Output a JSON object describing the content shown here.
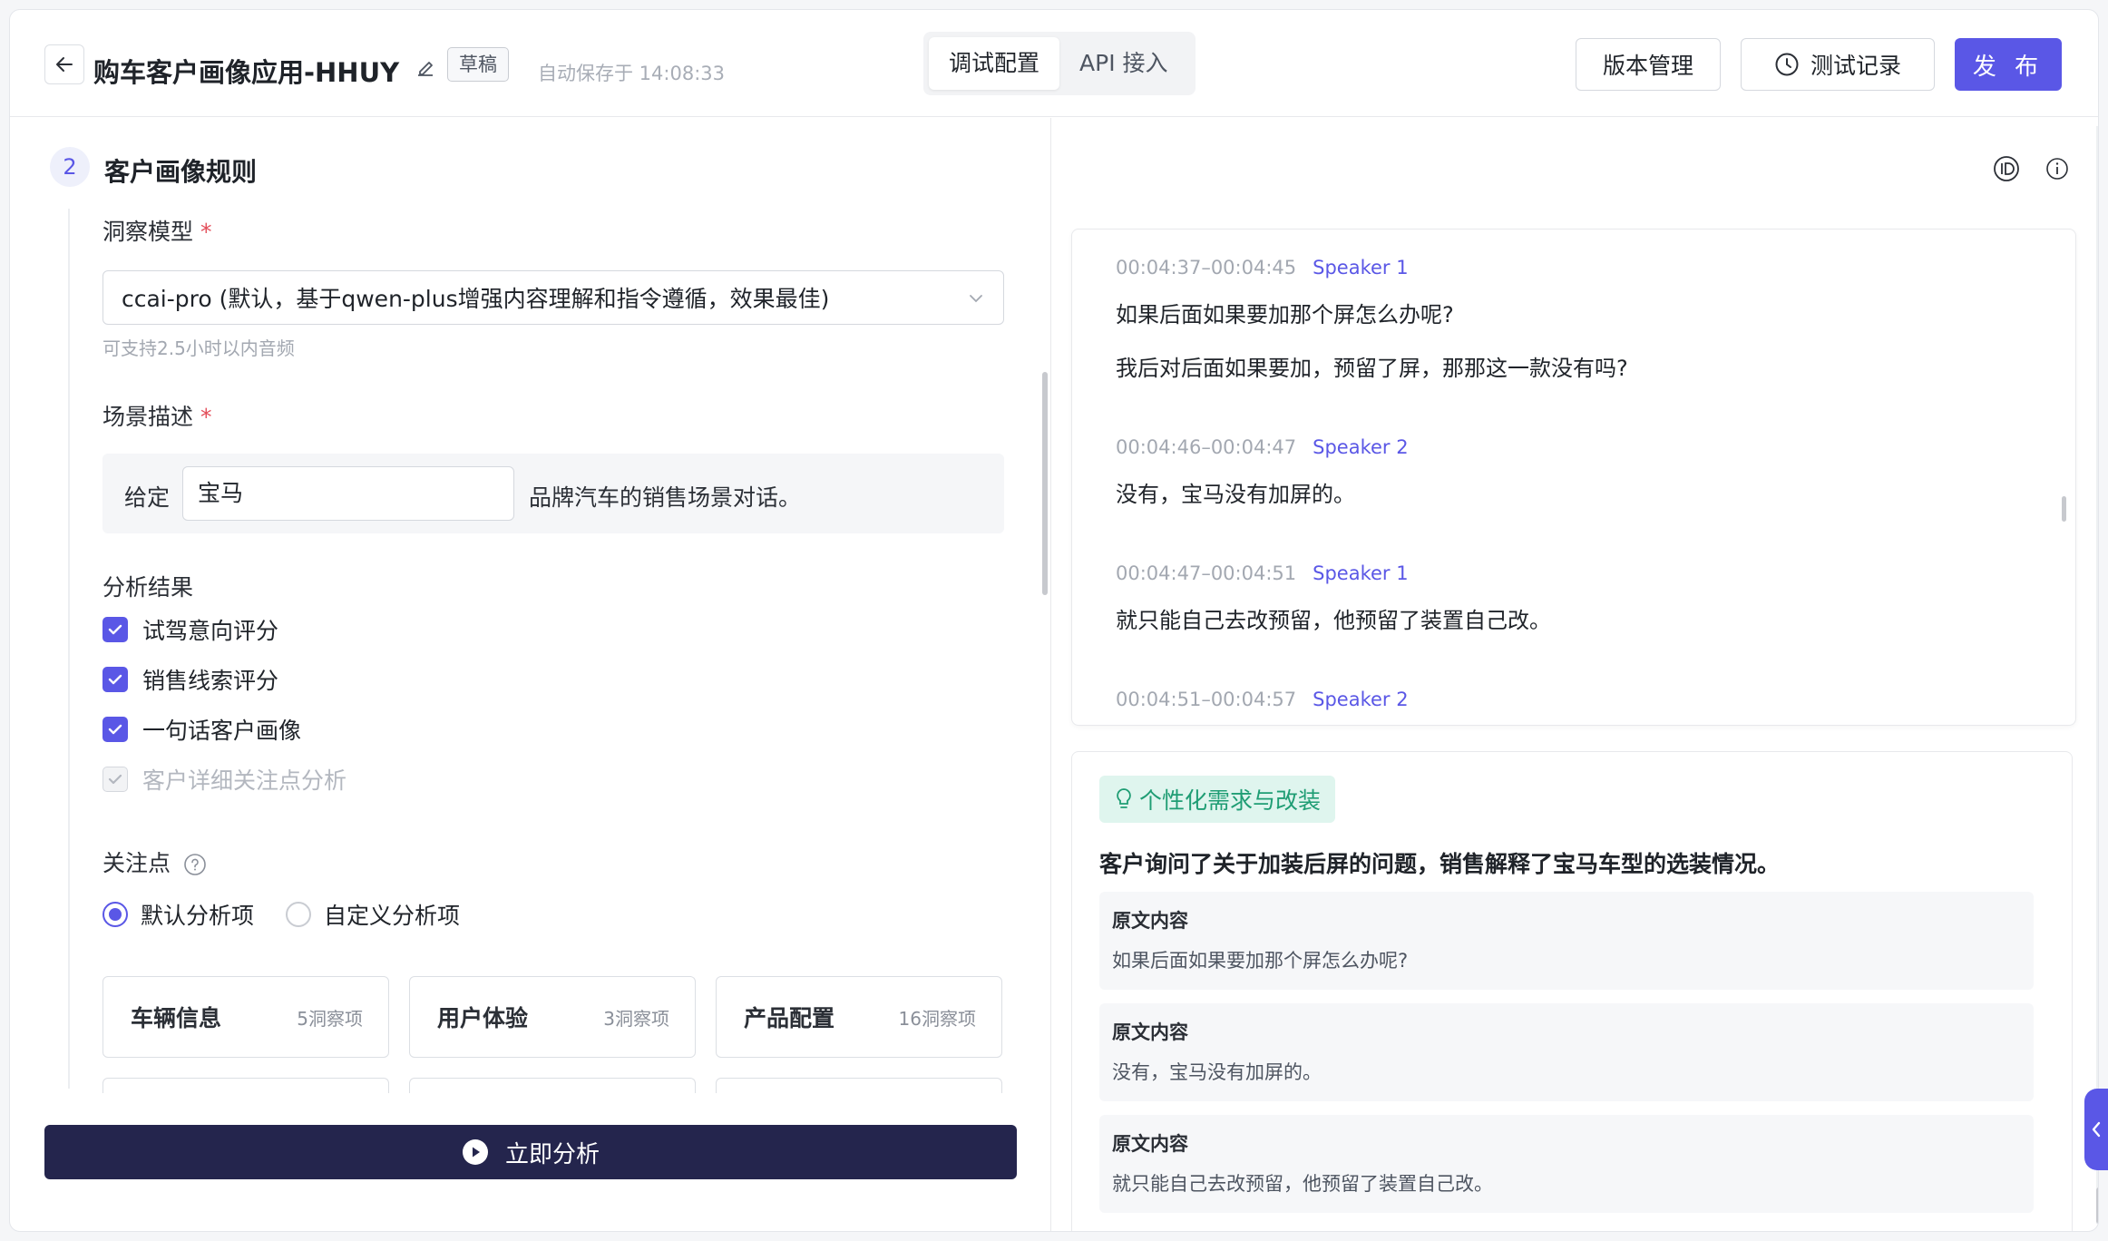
{
  "header": {
    "title": "购车客户画像应用-HHUY",
    "draft_badge": "草稿",
    "autosave_text": "自动保存于 14:08:33",
    "tabs": [
      {
        "label": "调试配置",
        "active": true
      },
      {
        "label": "API 接入",
        "active": false
      }
    ],
    "version_button": "版本管理",
    "test_record_button": "测试记录",
    "publish_button": "发 布"
  },
  "left": {
    "step_number": "2",
    "section_title": "客户画像规则",
    "model_label": "洞察模型",
    "model_value": "ccai-pro (默认，基于qwen-plus增强内容理解和指令遵循，效果最佳)",
    "model_hint": "可支持2.5小时以内音频",
    "scene_label": "场景描述",
    "scene_prefix": "给定",
    "scene_value": "宝马",
    "scene_suffix": "品牌汽车的销售场景对话。",
    "analysis_label": "分析结果",
    "checks": [
      {
        "label": "试驾意向评分",
        "checked": true,
        "disabled": false
      },
      {
        "label": "销售线索评分",
        "checked": true,
        "disabled": false
      },
      {
        "label": "一句话客户画像",
        "checked": true,
        "disabled": false
      },
      {
        "label": "客户详细关注点分析",
        "checked": true,
        "disabled": true
      }
    ],
    "focus_label": "关注点",
    "radios": [
      {
        "label": "默认分析项",
        "selected": true
      },
      {
        "label": "自定义分析项",
        "selected": false
      }
    ],
    "categories": [
      {
        "name": "车辆信息",
        "count": "5洞察项"
      },
      {
        "name": "用户体验",
        "count": "3洞察项"
      },
      {
        "name": "产品配置",
        "count": "16洞察项"
      }
    ],
    "analyze_button": "立即分析"
  },
  "transcript": {
    "segments": [
      {
        "time": "00:04:37–00:04:45",
        "speaker": "Speaker 1",
        "lines": [
          "如果后面如果要加那个屏怎么办呢?",
          "我后对后面如果要加，预留了屏，那那这一款没有吗?"
        ]
      },
      {
        "time": "00:04:46–00:04:47",
        "speaker": "Speaker 2",
        "lines": [
          "没有，宝马没有加屏的。"
        ]
      },
      {
        "time": "00:04:47–00:04:51",
        "speaker": "Speaker 1",
        "lines": [
          "就只能自己去改预留，他预留了装置自己改。"
        ]
      },
      {
        "time": "00:04:51–00:04:57",
        "speaker": "Speaker 2",
        "lines": []
      }
    ]
  },
  "insight": {
    "tag": "个性化需求与改装",
    "summary": "客户询问了关于加装后屏的问题，销售解释了宝马车型的选装情况。",
    "quotes": [
      {
        "title": "原文内容",
        "body": "如果后面如果要加那个屏怎么办呢?"
      },
      {
        "title": "原文内容",
        "body": "没有，宝马没有加屏的。"
      },
      {
        "title": "原文内容",
        "body": "就只能自己去改预留，他预留了装置自己改。"
      }
    ]
  },
  "colors": {
    "accent": "#5a57e6",
    "primary_dark": "#24254d",
    "tag_bg": "#dff5ee",
    "tag_text": "#1f9d74"
  },
  "icons": [
    "back-arrow-icon",
    "edit-icon",
    "clock-icon",
    "chevron-down-icon",
    "help-icon",
    "play-icon",
    "id-icon",
    "info-icon",
    "lightbulb-icon",
    "chevron-left-icon"
  ]
}
